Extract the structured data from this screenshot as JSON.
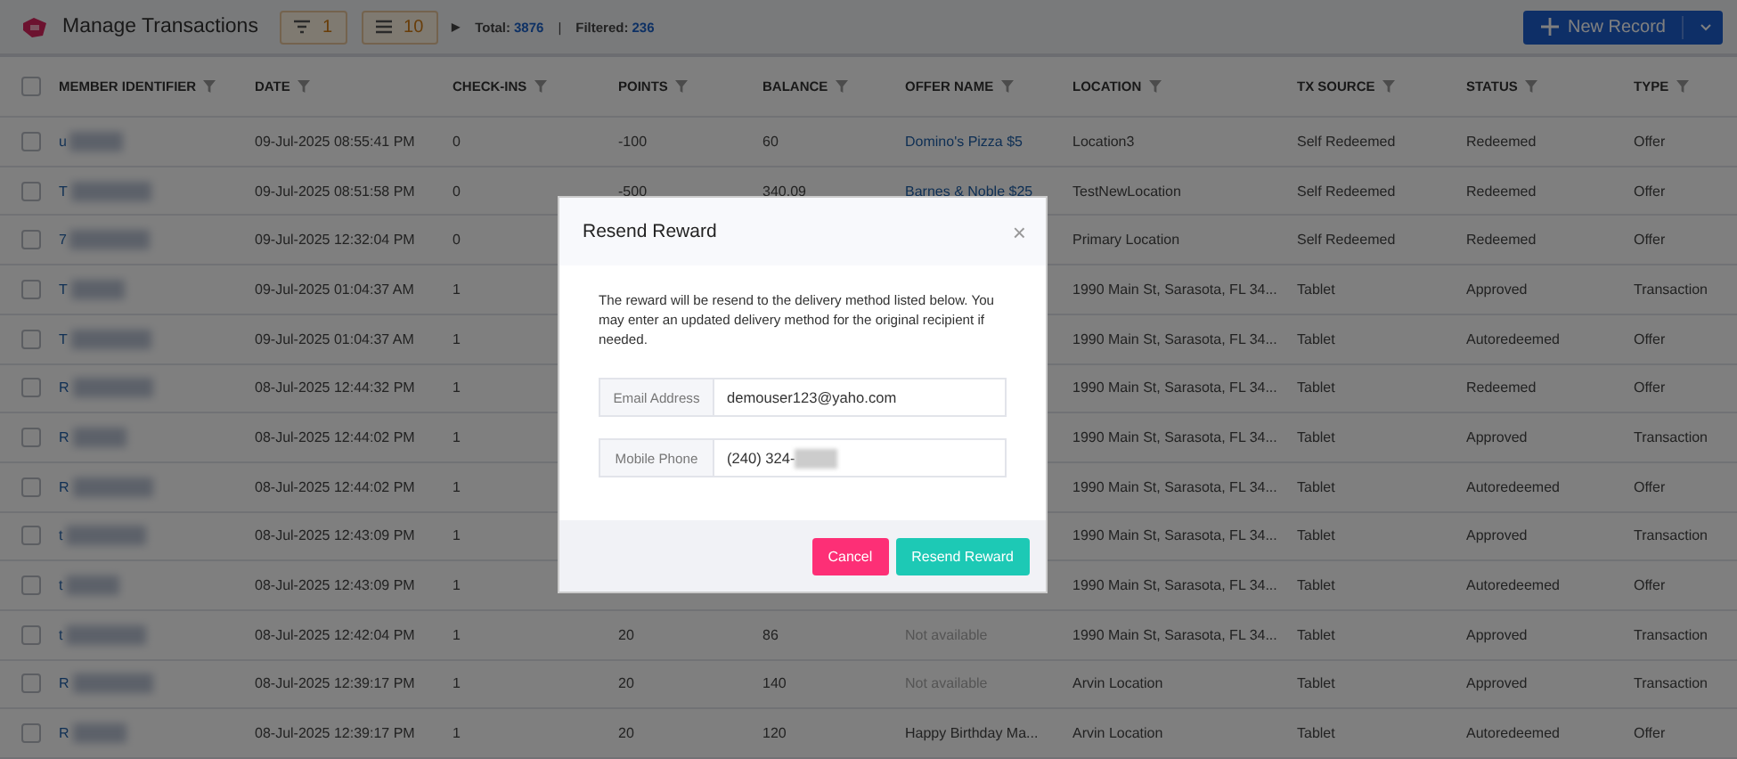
{
  "header": {
    "title": "Manage Transactions",
    "filter_count": "1",
    "column_count": "10",
    "expander": "▶",
    "total_label": "Total:",
    "total": "3876",
    "separator": "|",
    "filtered_label": "Filtered:",
    "filtered": "236",
    "new_button": "New Record"
  },
  "table": {
    "all_checked": false,
    "columns": [
      "MEMBER IDENTIFIER",
      "DATE",
      "CHECK-INS",
      "POINTS",
      "BALANCE",
      "OFFER NAME",
      "LOCATION",
      "TX SOURCE",
      "STATUS",
      "TYPE"
    ],
    "rows": [
      {
        "checked": false,
        "member": "u",
        "date": "09-Jul-2025 08:55:41 PM",
        "checkins": "0",
        "points": "-100",
        "balance": "60",
        "offer": {
          "text": "Domino's Pizza $5",
          "kind": "link"
        },
        "location": "Location3",
        "source": "Self Redeemed",
        "status": "Redeemed",
        "type": "Offer"
      },
      {
        "checked": false,
        "member": "T",
        "date": "09-Jul-2025 08:51:58 PM",
        "checkins": "0",
        "points": "-500",
        "balance": "340.09",
        "offer": {
          "text": "Barnes & Noble $25",
          "kind": "link"
        },
        "location": "TestNewLocation",
        "source": "Self Redeemed",
        "status": "Redeemed",
        "type": "Offer"
      },
      {
        "checked": false,
        "member": "7",
        "date": "09-Jul-2025 12:32:04 PM",
        "checkins": "0",
        "location": "Primary Location",
        "source": "Self Redeemed",
        "status": "Redeemed",
        "type": "Offer"
      },
      {
        "checked": false,
        "member": "T",
        "date": "09-Jul-2025 01:04:37 AM",
        "checkins": "1",
        "location": "1990 Main St, Sarasota, FL 34...",
        "source": "Tablet",
        "status": "Approved",
        "type": "Transaction"
      },
      {
        "checked": false,
        "member": "T",
        "date": "09-Jul-2025 01:04:37 AM",
        "checkins": "1",
        "location": "1990 Main St, Sarasota, FL 34...",
        "source": "Tablet",
        "status": "Autoredeemed",
        "type": "Offer"
      },
      {
        "checked": false,
        "member": "R",
        "date": "08-Jul-2025 12:44:32 PM",
        "checkins": "1",
        "location": "1990 Main St, Sarasota, FL 34...",
        "source": "Tablet",
        "status": "Redeemed",
        "type": "Offer"
      },
      {
        "checked": false,
        "member": "R",
        "date": "08-Jul-2025 12:44:02 PM",
        "checkins": "1",
        "location": "1990 Main St, Sarasota, FL 34...",
        "source": "Tablet",
        "status": "Approved",
        "type": "Transaction"
      },
      {
        "checked": false,
        "member": "R",
        "date": "08-Jul-2025 12:44:02 PM",
        "checkins": "1",
        "location": "1990 Main St, Sarasota, FL 34...",
        "source": "Tablet",
        "status": "Autoredeemed",
        "type": "Offer"
      },
      {
        "checked": false,
        "member": "t",
        "date": "08-Jul-2025 12:43:09 PM",
        "checkins": "1",
        "location": "1990 Main St, Sarasota, FL 34...",
        "source": "Tablet",
        "status": "Approved",
        "type": "Transaction"
      },
      {
        "checked": false,
        "member": "t",
        "date": "08-Jul-2025 12:43:09 PM",
        "checkins": "1",
        "location": "1990 Main St, Sarasota, FL 34...",
        "source": "Tablet",
        "status": "Autoredeemed",
        "type": "Offer"
      },
      {
        "checked": false,
        "member": "t",
        "date": "08-Jul-2025 12:42:04 PM",
        "checkins": "1",
        "points": "20",
        "balance": "86",
        "offer": {
          "text": "Not available",
          "kind": "muted"
        },
        "location": "1990 Main St, Sarasota, FL 34...",
        "source": "Tablet",
        "status": "Approved",
        "type": "Transaction"
      },
      {
        "checked": false,
        "member": "R",
        "date": "08-Jul-2025 12:39:17 PM",
        "checkins": "1",
        "points": "20",
        "balance": "140",
        "offer": {
          "text": "Not available",
          "kind": "muted"
        },
        "location": "Arvin Location",
        "source": "Tablet",
        "status": "Approved",
        "type": "Transaction"
      },
      {
        "checked": false,
        "member": "R",
        "date": "08-Jul-2025 12:39:17 PM",
        "checkins": "1",
        "points": "20",
        "balance": "120",
        "offer": {
          "text": "Happy Birthday Ma...",
          "kind": "plain"
        },
        "location": "Arvin Location",
        "source": "Tablet",
        "status": "Autoredeemed",
        "type": "Offer"
      }
    ]
  },
  "dialog": {
    "title": "Resend Reward",
    "close": "×",
    "message": "The reward will be resend to the delivery method listed below. You may enter an updated delivery method for the original recipient if needed.",
    "fields": [
      {
        "label": "Email Address",
        "value": "demouser123@yaho.com",
        "redacted": false
      },
      {
        "label": "Mobile Phone",
        "value": "(240) 324-",
        "redacted": true
      }
    ],
    "cancel": "Cancel",
    "confirm": "Resend Reward"
  }
}
